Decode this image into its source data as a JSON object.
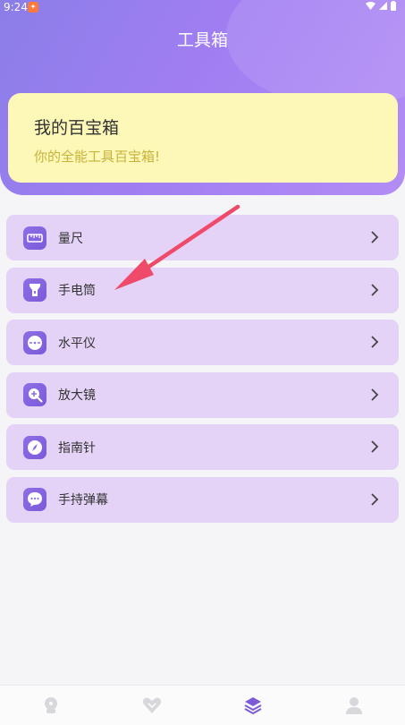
{
  "status_bar": {
    "time": "9:24"
  },
  "header": {
    "title": "工具箱"
  },
  "banner": {
    "title": "我的百宝箱",
    "subtitle": "你的全能工具百宝箱!"
  },
  "menu": {
    "items": [
      {
        "label": "量尺",
        "icon": "ruler-icon"
      },
      {
        "label": "手电筒",
        "icon": "flashlight-icon"
      },
      {
        "label": "水平仪",
        "icon": "level-icon"
      },
      {
        "label": "放大镜",
        "icon": "magnifier-icon"
      },
      {
        "label": "指南针",
        "icon": "compass-icon"
      },
      {
        "label": "手持弹幕",
        "icon": "chat-bubble-icon"
      }
    ]
  },
  "bottom_nav": {
    "items": [
      {
        "icon": "home-icon",
        "active": false
      },
      {
        "icon": "heart-icon",
        "active": false
      },
      {
        "icon": "layers-icon",
        "active": true
      },
      {
        "icon": "profile-icon",
        "active": false
      }
    ]
  },
  "colors": {
    "header_gradient_start": "#8b7ee8",
    "header_gradient_end": "#b38cf5",
    "banner_bg": "#fdf7b8",
    "banner_subtitle": "#c7b33a",
    "menu_item_bg": "#e5d2f7",
    "annotation_arrow": "#f04a6a",
    "active_nav": "#7b5cd6"
  }
}
